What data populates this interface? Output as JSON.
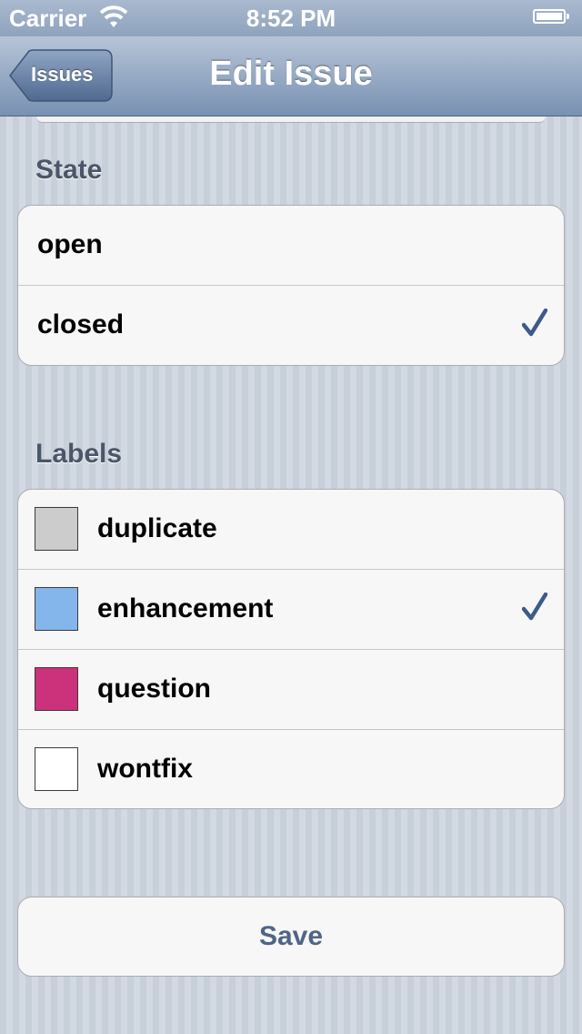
{
  "status_bar": {
    "carrier": "Carrier",
    "time": "8:52 PM",
    "wifi_icon": "wifi-icon",
    "battery_icon": "battery-icon"
  },
  "nav": {
    "title": "Edit Issue",
    "back_label": "Issues"
  },
  "state": {
    "header": "State",
    "options": [
      {
        "label": "open",
        "selected": false
      },
      {
        "label": "closed",
        "selected": true
      }
    ]
  },
  "labels": {
    "header": "Labels",
    "items": [
      {
        "label": "duplicate",
        "color": "#cccccc",
        "selected": false
      },
      {
        "label": "enhancement",
        "color": "#84b6eb",
        "selected": true
      },
      {
        "label": "question",
        "color": "#cc317c",
        "selected": false
      },
      {
        "label": "wontfix",
        "color": "#ffffff",
        "selected": false
      }
    ]
  },
  "save_label": "Save",
  "colors": {
    "checkmark": "#3d5a8a",
    "save_text": "#4f6587"
  }
}
